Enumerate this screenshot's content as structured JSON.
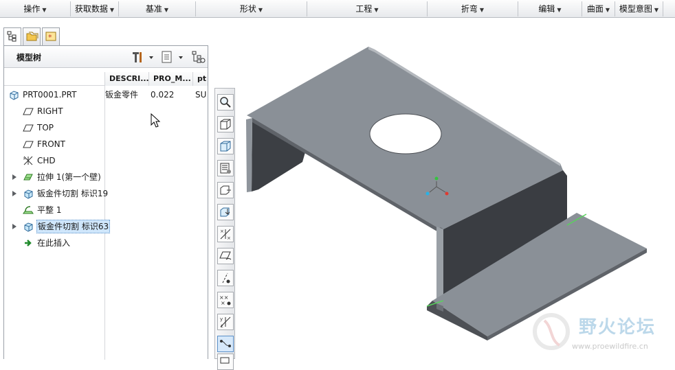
{
  "menu": [
    {
      "label": "操作"
    },
    {
      "label": "获取数据"
    },
    {
      "label": "基准"
    },
    {
      "label": "形状"
    },
    {
      "label": "工程"
    },
    {
      "label": "折弯"
    },
    {
      "label": "编辑"
    },
    {
      "label": "曲面"
    },
    {
      "label": "模型意图"
    }
  ],
  "panel": {
    "title": "模型树",
    "tabs": [
      "model-tree-tab-icon",
      "folder-browser-tab-icon",
      "favorites-tab-icon"
    ]
  },
  "columns": [
    "DESCRI...",
    "PRO_M...",
    "pt"
  ],
  "tree": [
    {
      "label": "PRT0001.PRT",
      "icon": "part-icon",
      "desc": "钣金零件",
      "pro_m": "0.022",
      "pt": "SU"
    },
    {
      "label": "RIGHT",
      "icon": "datum-plane-icon"
    },
    {
      "label": "TOP",
      "icon": "datum-plane-icon"
    },
    {
      "label": "FRONT",
      "icon": "datum-plane-icon"
    },
    {
      "label": "CHD",
      "icon": "coordinate-system-icon"
    },
    {
      "label": "拉伸 1(第一个壁)",
      "icon": "extrude-icon"
    },
    {
      "label": "钣金件切割 标识19",
      "icon": "sheetmetal-cut-icon"
    },
    {
      "label": "平整 1",
      "icon": "flat-icon"
    },
    {
      "label": "钣金件切割 标识63",
      "icon": "sheetmetal-cut-icon"
    },
    {
      "label": "在此插入",
      "icon": "insert-here-icon"
    }
  ],
  "watermark": {
    "title": "野火论坛",
    "url": "www.proewildfire.cn"
  },
  "colors": {
    "model_face": "#8a9097",
    "model_dark": "#45484d",
    "edge_highlight": "#58d35c",
    "selection": "#cfe6fb"
  }
}
